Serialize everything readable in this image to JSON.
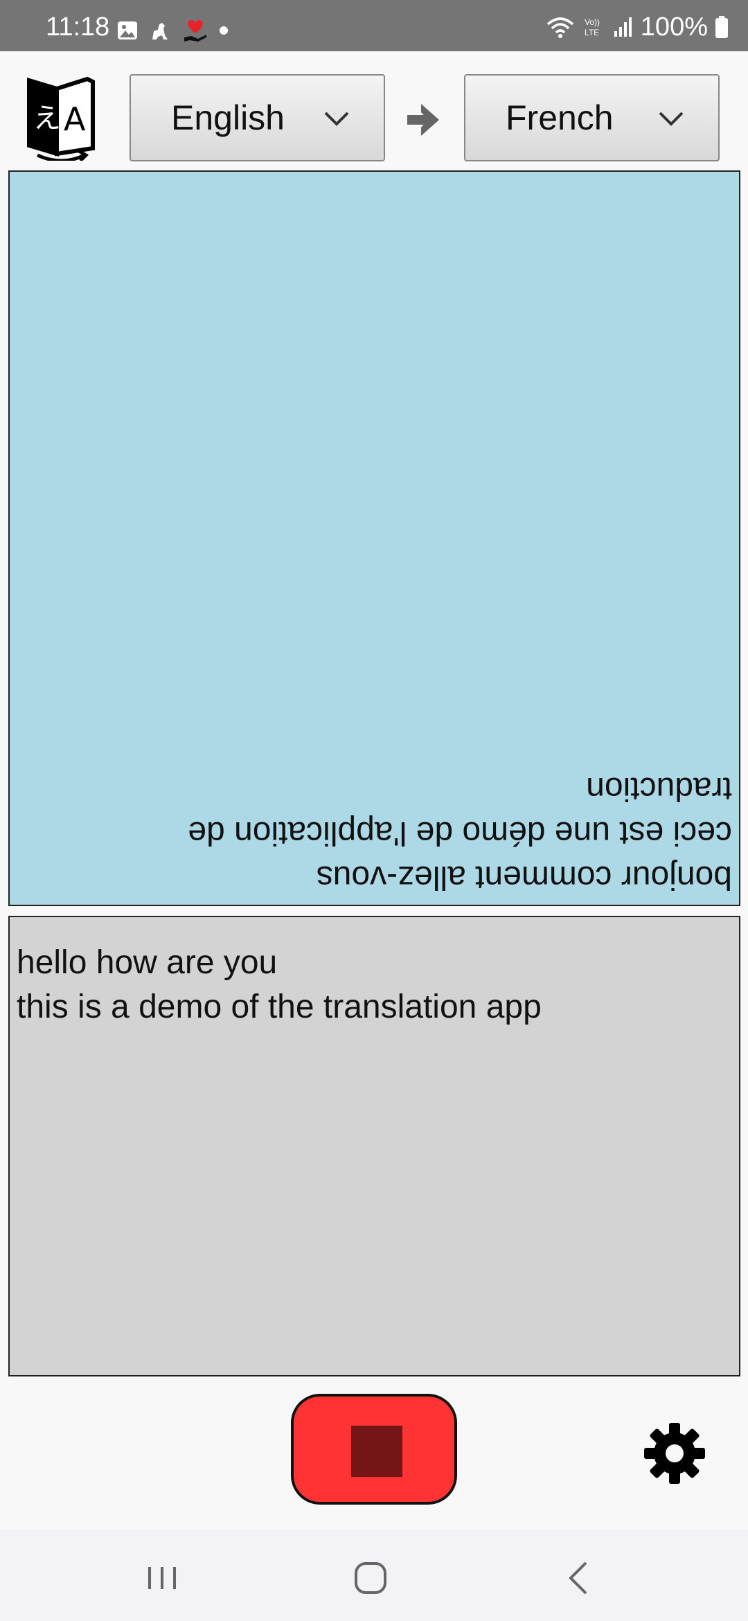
{
  "status_bar": {
    "time": "11:18",
    "battery": "100%",
    "icons": [
      "image-icon",
      "dog-icon",
      "heart-hand-icon",
      "dot-icon",
      "wifi-icon",
      "volte-icon",
      "signal-icon",
      "battery-icon"
    ]
  },
  "header": {
    "logo_icon": "translate-book-icon",
    "source_language": "English",
    "target_language": "French",
    "arrow_icon": "arrow-right-icon"
  },
  "translated_panel": {
    "lines": [
      "bonjour comment allez-vous",
      "ceci est une démo de l'application de",
      "traduction"
    ],
    "background": "#add8e6",
    "orientation": "upside-down"
  },
  "source_panel": {
    "lines": [
      "hello how are you",
      "this is a demo of the translation app"
    ],
    "background": "#d3d3d3"
  },
  "controls": {
    "record_state": "recording",
    "record_color": "#ff3333",
    "settings_icon": "gear-icon"
  },
  "nav_bar": {
    "buttons": [
      "recents-icon",
      "home-icon",
      "back-icon"
    ]
  }
}
